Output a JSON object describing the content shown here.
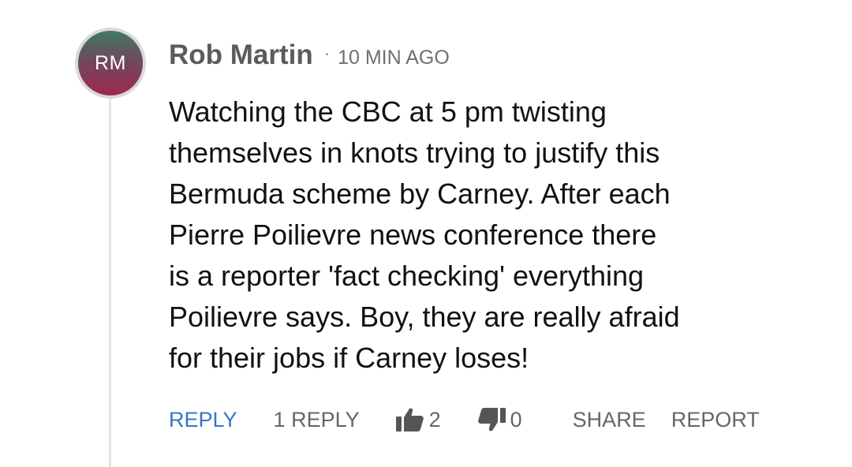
{
  "comment": {
    "avatar_initials": "RM",
    "author": "Rob Martin",
    "separator": "·",
    "timestamp": "10 MIN AGO",
    "body_lines": [
      "Watching the CBC at 5 pm twisting",
      "themselves in knots trying to justify this",
      "Bermuda scheme by Carney. After each",
      "Pierre Poilievre news conference there",
      "is a reporter 'fact checking' everything",
      "Poilievre says. Boy, they are really afraid",
      "for their jobs if Carney loses!"
    ],
    "actions": {
      "reply_label": "REPLY",
      "replies_label": "1 REPLY",
      "like_icon": "thumbs-up-icon",
      "like_count": "2",
      "dislike_icon": "thumbs-down-icon",
      "dislike_count": "0",
      "share_label": "SHARE",
      "report_label": "REPORT"
    }
  },
  "colors": {
    "reply_link": "#3a74c8",
    "action_text": "#666666",
    "author_text": "#5b5b5b",
    "body_text": "#111111",
    "thread_line": "#e4e4e4",
    "avatar_gradient_top": "#3f7a63",
    "avatar_gradient_bottom": "#a0284f"
  }
}
